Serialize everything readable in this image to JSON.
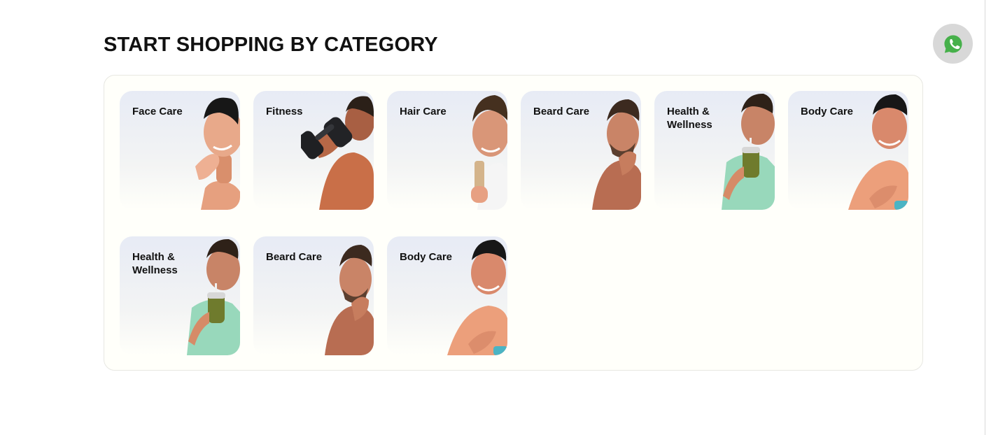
{
  "section": {
    "title": "START SHOPPING BY CATEGORY"
  },
  "floating_action": {
    "icon": "whatsapp-icon"
  },
  "colors": {
    "whatsapp_green": "#46b04a",
    "card_gradient_top": "#e7ebf5",
    "panel_background": "#fffffa"
  },
  "categories": [
    {
      "label": "Face Care",
      "image_name": "face-care-image"
    },
    {
      "label": "Fitness",
      "image_name": "fitness-image"
    },
    {
      "label": "Hair Care",
      "image_name": "hair-care-image"
    },
    {
      "label": "Beard Care",
      "image_name": "beard-care-image"
    },
    {
      "label": "Health & Wellness",
      "image_name": "health-wellness-image"
    },
    {
      "label": "Body Care",
      "image_name": "body-care-image"
    },
    {
      "label": "Health & Wellness",
      "image_name": "health-wellness-image"
    },
    {
      "label": "Beard Care",
      "image_name": "beard-care-image"
    },
    {
      "label": "Body Care",
      "image_name": "body-care-image"
    }
  ]
}
